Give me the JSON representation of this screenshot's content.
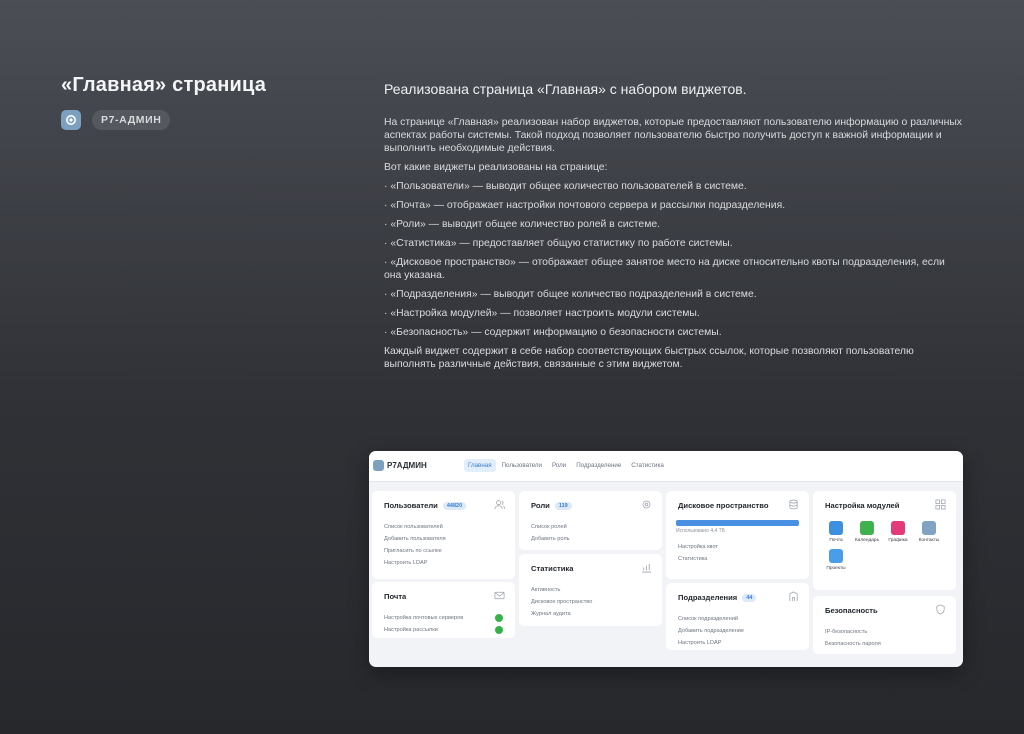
{
  "left": {
    "title": "«Главная» страница",
    "tag": "Р7-АДМИН"
  },
  "right": {
    "heading": "Реализована страница «Главная» с набором виджетов.",
    "intro": "На странице «Главная» реализован набор виджетов, которые предоставляют пользователю информацию о различных аспектах работы системы. Такой подход позволяет пользователю быстро получить доступ к важной информации и выполнить необходимые действия.",
    "list_title": "Вот какие виджеты реализованы на странице:",
    "items": [
      "· «Пользователи» — выводит общее количество пользователей в системе.",
      "· «Почта» — отображает  настройки почтового сервера и рассылки подразделения.",
      "· «Роли» — выводит общее количество ролей в системе.",
      "· «Статистика» — предоставляет общую статистику по работе системы.",
      "· «Дисковое пространство» — отображает общее занятое место на диске относительно квоты подразделения, если она указана.",
      "· «Подразделения» — выводит общее количество подразделений в системе.",
      "· «Настройка модулей» — позволяет настроить модули системы.",
      "· «Безопасность» — содержит информацию о безопасности системы."
    ],
    "outro": "Каждый виджет содержит в себе набор соответствующих быстрых ссылок, которые позволяют пользователю выполнять различные действия, связанные с этим виджетом."
  },
  "app": {
    "logo": "Р7АДМИН",
    "nav": [
      "Главная",
      "Пользователи",
      "Роли",
      "Подразделение",
      "Статистика"
    ],
    "users": {
      "title": "Пользователи",
      "count": "44820",
      "links": [
        "Список пользователей",
        "Добавить пользователя",
        "Пригласить по ссылке",
        "Настроить LDAP"
      ]
    },
    "mail": {
      "title": "Почта",
      "links": [
        "Настройка почтовых серверов",
        "Настройка рассылки"
      ]
    },
    "roles": {
      "title": "Роли",
      "count": "119",
      "links": [
        "Список ролей",
        "Добавить роль"
      ]
    },
    "stats": {
      "title": "Статистика",
      "links": [
        "Активность",
        "Дисковое пространство",
        "Журнал аудита"
      ]
    },
    "disk": {
      "title": "Дисковое пространство",
      "used_label": "Использовано 4,4 ТБ",
      "used_fraction": 1.0,
      "links": [
        "Настройка квот",
        "Статистика"
      ]
    },
    "departments": {
      "title": "Подразделения",
      "count": "44",
      "links": [
        "Список подразделений",
        "Добавить подразделение",
        "Настроить LDAP"
      ]
    },
    "modules": {
      "title": "Настройка модулей",
      "items": [
        {
          "label": "Почта",
          "color": "#3d8fe0"
        },
        {
          "label": "Календарь",
          "color": "#3fb24f"
        },
        {
          "label": "Графика",
          "color": "#e23a7a"
        },
        {
          "label": "Контакты",
          "color": "#7fa3c2"
        },
        {
          "label": "Проекты",
          "color": "#4a9de8"
        }
      ]
    },
    "security": {
      "title": "Безопасность",
      "links": [
        "IP-безопасность",
        "Безопасность пароля"
      ]
    }
  }
}
